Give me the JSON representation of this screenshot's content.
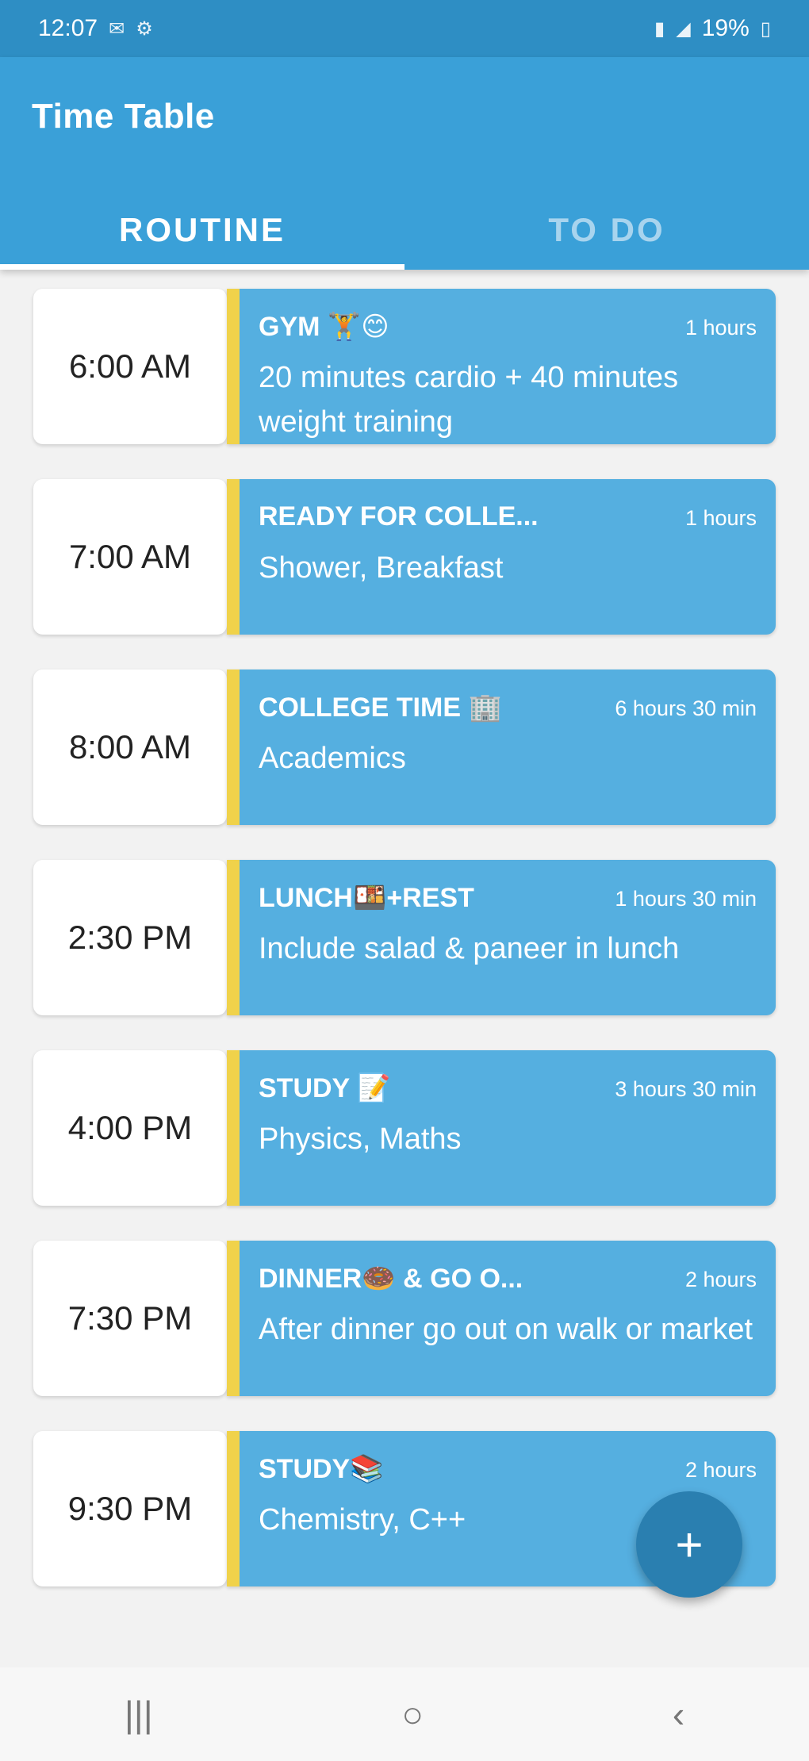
{
  "status_bar": {
    "time": "12:07",
    "battery": "19%",
    "icons": [
      "notification-icon",
      "settings-icon",
      "signal-icon",
      "wifi-icon",
      "battery-icon"
    ]
  },
  "app": {
    "title": "Time Table"
  },
  "tabs": [
    {
      "label": "ROUTINE",
      "active": true
    },
    {
      "label": "TO DO",
      "active": false
    }
  ],
  "routine": [
    {
      "time": "6:00 AM",
      "title": "GYM 🏋😊",
      "duration": "1 hours",
      "desc": "20 minutes cardio + 40 minutes weight training"
    },
    {
      "time": "7:00 AM",
      "title": "READY FOR COLLE...",
      "duration": "1 hours",
      "desc": "Shower, Breakfast"
    },
    {
      "time": "8:00 AM",
      "title": "COLLEGE TIME 🏢",
      "duration": "6 hours 30 min",
      "desc": "Academics"
    },
    {
      "time": "2:30 PM",
      "title": "LUNCH🍱+REST",
      "duration": "1 hours 30 min",
      "desc": "Include salad & paneer in lunch"
    },
    {
      "time": "4:00 PM",
      "title": "STUDY 📝",
      "duration": "3 hours 30 min",
      "desc": "Physics, Maths"
    },
    {
      "time": "7:30 PM",
      "title": "DINNER🍩 & GO O...",
      "duration": "2 hours",
      "desc": "After dinner go out on walk or market"
    },
    {
      "time": "9:30 PM",
      "title": "STUDY📚",
      "duration": "2 hours",
      "desc": "Chemistry, C++"
    }
  ],
  "fab": {
    "label": "+"
  },
  "nav": {
    "recent": "|||",
    "home": "○",
    "back": "‹"
  },
  "colors": {
    "status_bar": "#2e8ec4",
    "app_bar": "#3aa0d8",
    "event_card": "#55afe0",
    "accent_stripe": "#f0d24a",
    "fab": "#2a7fb0"
  }
}
